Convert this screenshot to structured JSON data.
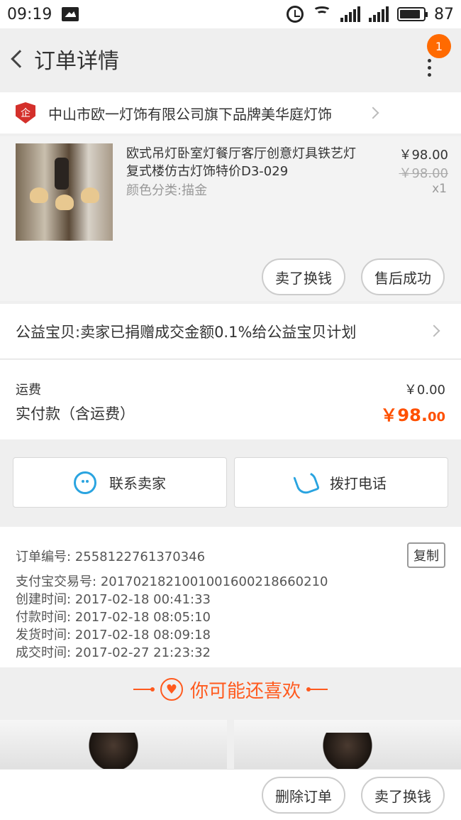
{
  "status_bar": {
    "time": "09:19",
    "battery": "87"
  },
  "header": {
    "title": "订单详情",
    "badge": "1"
  },
  "shop": {
    "name": "中山市欧一灯饰有限公司旗下品牌美华庭灯饰",
    "logo_text": "企"
  },
  "product": {
    "title": "欧式吊灯卧室灯餐厅客厅创意灯具铁艺灯复式楼仿古灯饰特价D3-029",
    "sku": "颜色分类:描金",
    "price": "￥98.00",
    "original_price": "￥98.00",
    "quantity": "x1",
    "actions": {
      "resell": "卖了换钱",
      "after_sale": "售后成功"
    }
  },
  "charity": {
    "text": "公益宝贝:卖家已捐赠成交金额0.1%给公益宝贝计划"
  },
  "fees": {
    "shipping_label": "运费",
    "shipping_value": "￥0.00",
    "paid_label": "实付款（含运费）",
    "paid_value": "￥98.",
    "paid_decimal": "00"
  },
  "contact": {
    "seller": "联系卖家",
    "phone": "拨打电话"
  },
  "order_info": {
    "copy_label": "复制",
    "lines": [
      {
        "label": "订单编号:",
        "value": "2558122761370346"
      },
      {
        "label": "支付宝交易号:",
        "value": "2017021821001001600218660210"
      },
      {
        "label": "创建时间:",
        "value": "2017-02-18 00:41:33"
      },
      {
        "label": "付款时间:",
        "value": "2017-02-18 08:05:10"
      },
      {
        "label": "发货时间:",
        "value": "2017-02-18 08:09:18"
      },
      {
        "label": "成交时间:",
        "value": "2017-02-27 21:23:32"
      }
    ]
  },
  "recommend": {
    "title": "你可能还喜欢"
  },
  "bottom_bar": {
    "delete": "删除订单",
    "resell": "卖了换钱"
  },
  "colors": {
    "accent": "#ff5000",
    "blue": "#2aa4e0",
    "shop_logo": "#d4302b"
  },
  "icons": [
    "back-icon",
    "more-icon",
    "shop-logo-icon",
    "chevron-right-icon",
    "chat-icon",
    "phone-icon",
    "heart-icon",
    "alarm-icon",
    "wifi-icon",
    "signal-icon",
    "battery-icon",
    "message-icon"
  ]
}
